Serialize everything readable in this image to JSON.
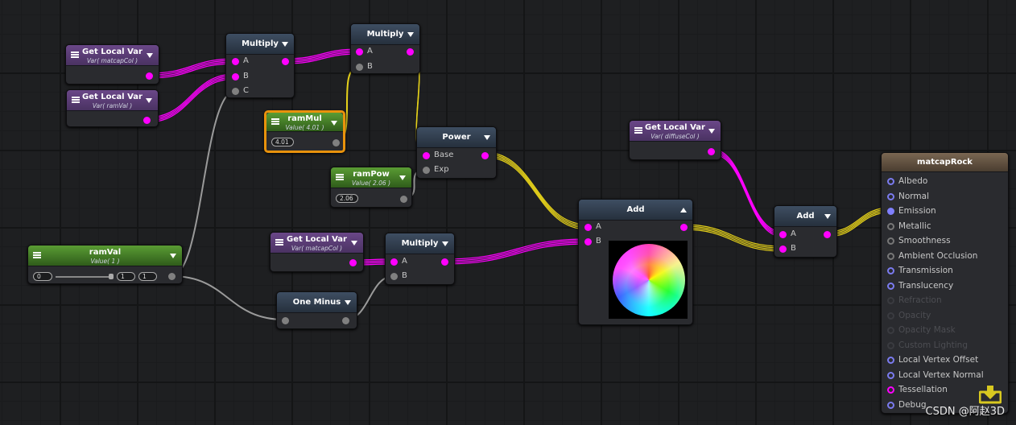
{
  "nodes": {
    "glv1": {
      "title": "Get Local Var",
      "sub": "Var( matcapCol )"
    },
    "glv2": {
      "title": "Get Local Var",
      "sub": "Var( ramVal )"
    },
    "glv3": {
      "title": "Get Local Var",
      "sub": "Var( diffuseCol )"
    },
    "glv4": {
      "title": "Get Local Var",
      "sub": "Var( matcapCol )"
    },
    "mul1": {
      "title": "Multiply",
      "ports": [
        "A",
        "B",
        "C"
      ]
    },
    "mul2": {
      "title": "Multiply",
      "ports": [
        "A",
        "B"
      ]
    },
    "mul3": {
      "title": "Multiply",
      "ports": [
        "A",
        "B"
      ]
    },
    "ramMul": {
      "title": "ramMul",
      "sub": "Value( 4.01 )",
      "value": "4.01"
    },
    "ramPow": {
      "title": "ramPow",
      "sub": "Value( 2.06 )",
      "value": "2.06"
    },
    "ramVal": {
      "title": "ramVal",
      "sub": "Value( 1 )",
      "min": "0",
      "value": "1",
      "max": "1"
    },
    "power": {
      "title": "Power",
      "ports": [
        "Base",
        "Exp"
      ]
    },
    "oneMinus": {
      "title": "One Minus"
    },
    "add1": {
      "title": "Add",
      "ports": [
        "A",
        "B"
      ]
    },
    "add2": {
      "title": "Add",
      "ports": [
        "A",
        "B"
      ]
    },
    "output": {
      "title": "matcapRock",
      "ports": [
        "Albedo",
        "Normal",
        "Emission",
        "Metallic",
        "Smoothness",
        "Ambient Occlusion",
        "Transmission",
        "Translucency",
        "Refraction",
        "Opacity",
        "Opacity Mask",
        "Custom Lighting",
        "Local Vertex Offset",
        "Local Vertex Normal",
        "Tessellation",
        "Debug"
      ]
    }
  },
  "colors": {
    "vector_wire": "#ff00ff",
    "float_wire": "#e6d21a",
    "generic_wire": "#9a9a9a",
    "selected_border": "#e8920c"
  },
  "watermark": "CSDN @阿赵3D"
}
